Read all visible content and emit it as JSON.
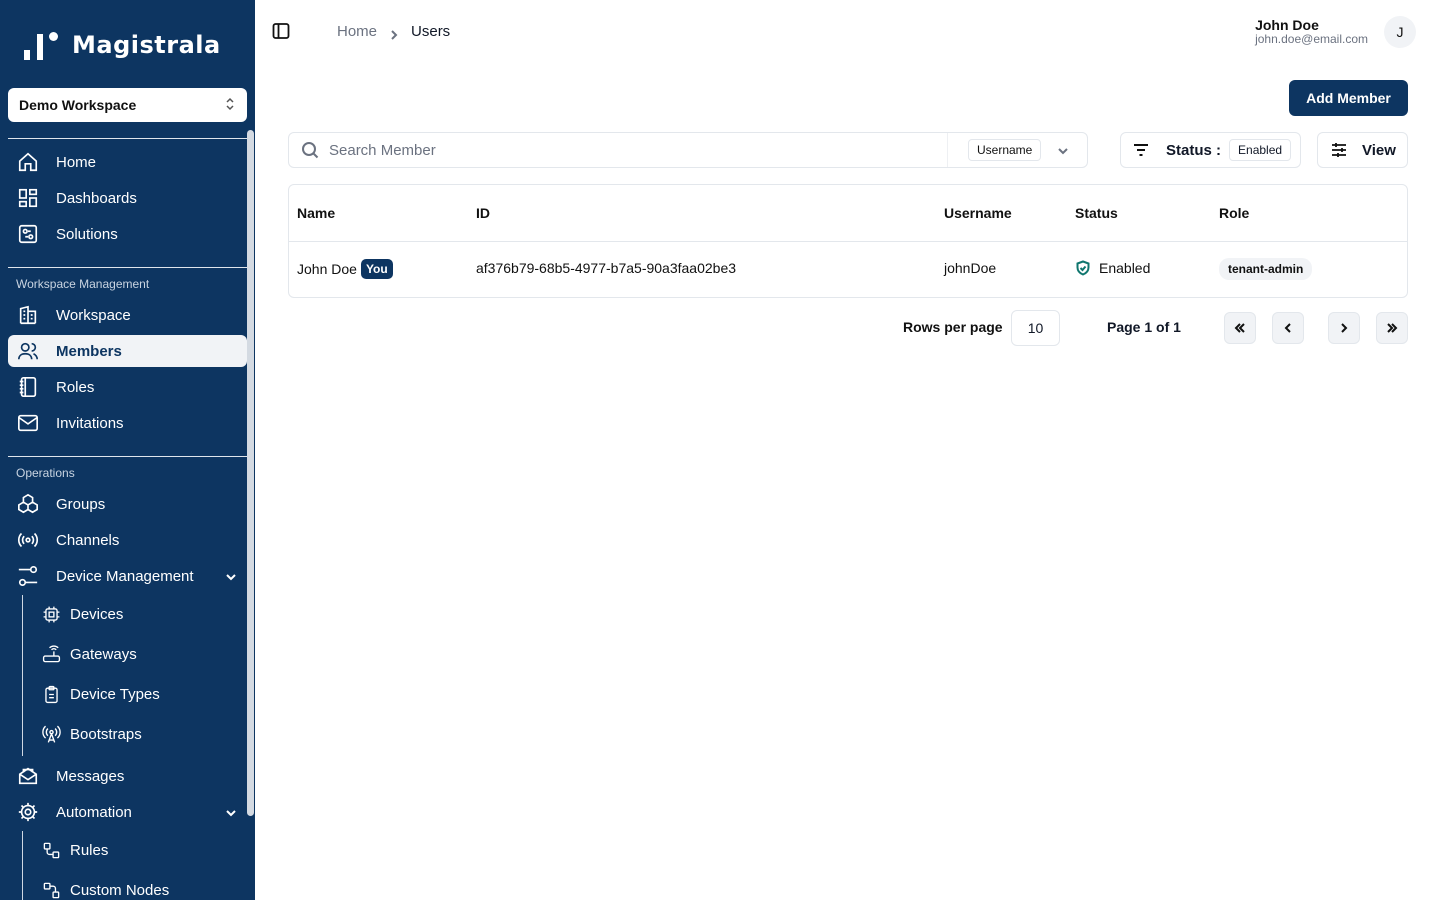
{
  "app": {
    "name": "Magistrala"
  },
  "workspace_selector": {
    "value": "Demo Workspace"
  },
  "sidebar": {
    "main": [
      {
        "label": "Home",
        "icon": "home-icon"
      },
      {
        "label": "Dashboards",
        "icon": "dashboards-icon"
      },
      {
        "label": "Solutions",
        "icon": "solutions-icon"
      }
    ],
    "workspace_section": "Workspace Management",
    "workspace_items": [
      {
        "label": "Workspace",
        "icon": "building-icon"
      },
      {
        "label": "Members",
        "icon": "users-icon",
        "active": true
      },
      {
        "label": "Roles",
        "icon": "notebook-icon"
      },
      {
        "label": "Invitations",
        "icon": "mail-icon"
      }
    ],
    "operations_section": "Operations",
    "operations_items": [
      {
        "label": "Groups",
        "icon": "boxes-icon"
      },
      {
        "label": "Channels",
        "icon": "radio-icon"
      },
      {
        "label": "Device Management",
        "icon": "route-icon",
        "expanded": true
      }
    ],
    "device_sub": [
      {
        "label": "Devices",
        "icon": "cpu-icon"
      },
      {
        "label": "Gateways",
        "icon": "router-icon"
      },
      {
        "label": "Device Types",
        "icon": "clipboard-icon"
      },
      {
        "label": "Bootstraps",
        "icon": "antenna-icon"
      }
    ],
    "more_items": [
      {
        "label": "Messages",
        "icon": "mail-open-icon"
      },
      {
        "label": "Automation",
        "icon": "cog-icon",
        "expanded": true
      }
    ],
    "automation_sub": [
      {
        "label": "Rules",
        "icon": "workflow-icon"
      },
      {
        "label": "Custom Nodes",
        "icon": "nodes-icon"
      }
    ]
  },
  "header": {
    "breadcrumb": [
      "Home",
      "Users"
    ],
    "user": {
      "name": "John Doe",
      "email": "john.doe@email.com",
      "initial": "J"
    }
  },
  "toolbar": {
    "add_label": "Add Member",
    "search_placeholder": "Search Member",
    "search_field": "Username",
    "status_label": "Status :",
    "status_value": "Enabled",
    "view_label": "View"
  },
  "table": {
    "columns": [
      "Name",
      "ID",
      "Username",
      "Status",
      "Role"
    ],
    "rows": [
      {
        "name": "John Doe",
        "badge": "You",
        "id": "af376b79-68b5-4977-b7a5-90a3faa02be3",
        "username": "johnDoe",
        "status": "Enabled",
        "role": "tenant-admin"
      }
    ]
  },
  "pagination": {
    "rows_label": "Rows per page",
    "rows_value": "10",
    "page_label": "Page 1 of 1"
  },
  "colors": {
    "primary": "#0d3561",
    "status_ok": "#0f766e"
  }
}
